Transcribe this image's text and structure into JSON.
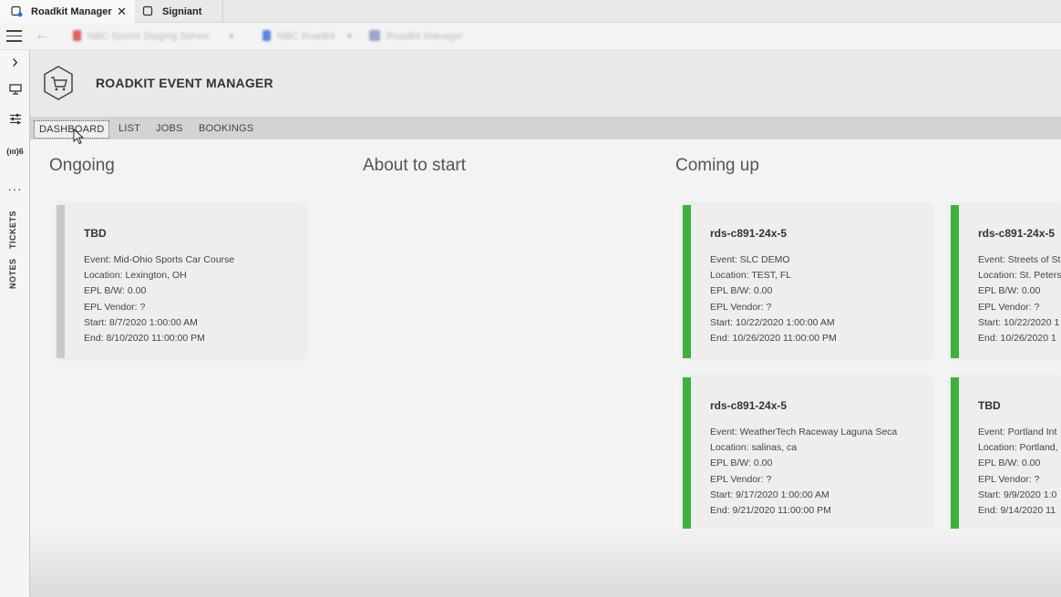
{
  "tabs": [
    {
      "label": "Roadkit Manager",
      "close": "✕"
    },
    {
      "label": "Signiant"
    }
  ],
  "toolbar": {
    "back": "←",
    "breadcrumbs": [
      "NBC Sports Staging Server",
      "NBC Roadkit",
      "Roadkit Manager"
    ],
    "crumb_chevron": "▾"
  },
  "rail": {
    "expand": "›",
    "signal_count": "(ııı)6",
    "more": "···",
    "tickets": "TICKETS",
    "notes": "NOTES"
  },
  "app": {
    "title": "ROADKIT EVENT MANAGER"
  },
  "nav": [
    {
      "label": "DASHBOARD",
      "selected": true
    },
    {
      "label": "LIST"
    },
    {
      "label": "JOBS"
    },
    {
      "label": "BOOKINGS"
    }
  ],
  "columns": {
    "ongoing": "Ongoing",
    "about": "About to start",
    "coming": "Coming up"
  },
  "colors": {
    "green": "#3cb23c",
    "grey_bar": "#c8c8c8"
  },
  "cards": {
    "ongoing": [
      {
        "title": "TBD",
        "event": "Event: Mid-Ohio Sports Car Course",
        "location": "Location: Lexington, OH",
        "bw": "EPL B/W: 0.00",
        "vendor": "EPL Vendor: ?",
        "start": "Start: 8/7/2020 1:00:00 AM",
        "end": "End: 8/10/2020 11:00:00 PM"
      }
    ],
    "coming": [
      {
        "title": "rds-c891-24x-5",
        "event": "Event: SLC DEMO",
        "location": "Location: TEST, FL",
        "bw": "EPL B/W: 0.00",
        "vendor": "EPL Vendor: ?",
        "start": "Start: 10/22/2020 1:00:00 AM",
        "end": "End: 10/26/2020 11:00:00 PM"
      },
      {
        "title": "rds-c891-24x-5",
        "event": "Event: Streets of St",
        "location": "Location: St. Peters",
        "bw": "EPL B/W: 0.00",
        "vendor": "EPL Vendor: ?",
        "start": "Start: 10/22/2020 1",
        "end": "End: 10/26/2020 1"
      },
      {
        "title": "rds-c891-24x-5",
        "event": "Event: WeatherTech Raceway Laguna Seca",
        "location": "Location: salinas, ca",
        "bw": "EPL B/W: 0.00",
        "vendor": "EPL Vendor: ?",
        "start": "Start: 9/17/2020 1:00:00 AM",
        "end": "End: 9/21/2020 11:00:00 PM"
      },
      {
        "title": "TBD",
        "event": "Event: Portland Int",
        "location": "Location: Portland,",
        "bw": "EPL B/W: 0.00",
        "vendor": "EPL Vendor: ?",
        "start": "Start: 9/9/2020 1:0",
        "end": "End: 9/14/2020 11"
      }
    ]
  }
}
